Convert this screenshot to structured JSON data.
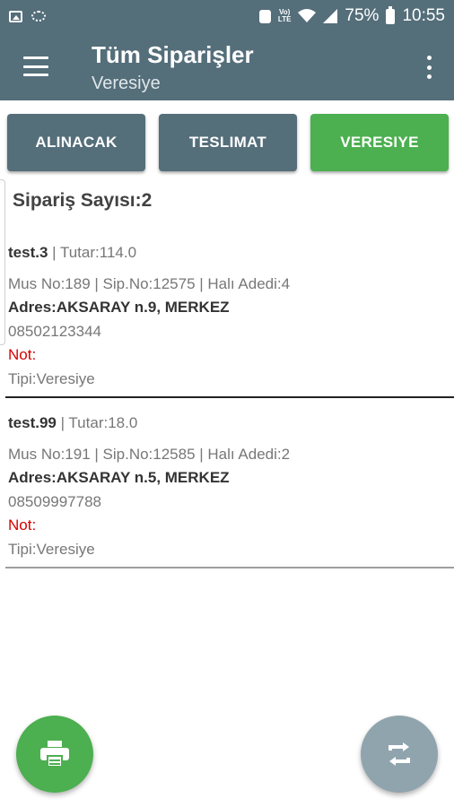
{
  "status_bar": {
    "battery": "75%",
    "time": "10:55",
    "icons": [
      "image-icon",
      "cast-icon",
      "alarm-icon",
      "volte-icon",
      "wifi-icon",
      "signal-icon",
      "battery-icon"
    ]
  },
  "app_bar": {
    "title": "Tüm Siparişler",
    "subtitle": "Veresiye"
  },
  "tabs": [
    {
      "label": "ALINACAK",
      "active": false
    },
    {
      "label": "TESLIMAT",
      "active": false
    },
    {
      "label": "VERESIYE",
      "active": true
    }
  ],
  "order_count": "Sipariş Sayısı:2",
  "orders": [
    {
      "name": "test.3",
      "total": " | Tutar:114.0",
      "info": "Mus No:189 | Sip.No:12575 | Halı Adedi:4",
      "address": "Adres:AKSARAY n.9, MERKEZ",
      "phone": "08502123344",
      "note": "Not:",
      "type": "Tipi:Veresiye"
    },
    {
      "name": "test.99",
      "total": " | Tutar:18.0",
      "info": "Mus No:191 | Sip.No:12585 | Halı Adedi:2",
      "address": "Adres:AKSARAY n.5, MERKEZ",
      "phone": "08509997788",
      "note": "Not:",
      "type": "Tipi:Veresiye"
    }
  ],
  "fabs": {
    "print_icon": "printer-icon",
    "refresh_icon": "refresh-icon"
  },
  "colors": {
    "primary": "#546e7a",
    "active_tab": "#4caf50",
    "note_red": "#d50000",
    "refresh_fab": "#90a4ae"
  }
}
